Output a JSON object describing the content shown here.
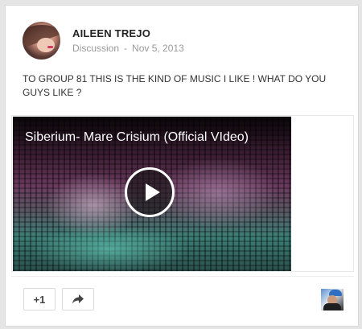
{
  "post": {
    "author": "AILEEN TREJO",
    "category": "Discussion",
    "separator": "-",
    "date": "Nov 5, 2013",
    "text": "TO GROUP 81 THIS IS THE KIND OF MUSIC I LIKE ! WHAT DO YOU GUYS LIKE ?"
  },
  "video": {
    "title": "Siberium- Mare Crisium (Official VIdeo)"
  },
  "actions": {
    "plus_one_label": "+1"
  },
  "icons": {
    "author_avatar": "avatar-icon",
    "play": "play-icon",
    "share": "share-icon",
    "viewer_avatar": "avatar-icon"
  }
}
